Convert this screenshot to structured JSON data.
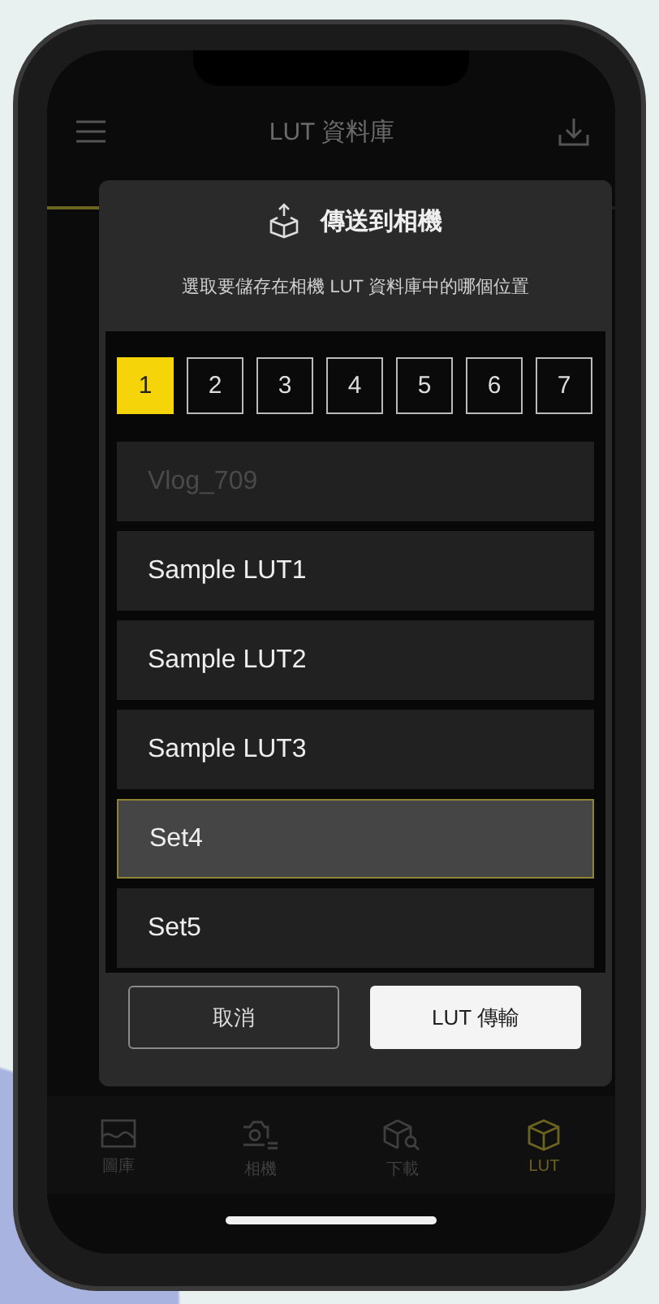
{
  "header": {
    "title": "LUT 資料庫"
  },
  "dialog": {
    "title": "傳送到相機",
    "subtitle": "選取要儲存在相機 LUT 資料庫中的哪個位置",
    "slots": [
      {
        "label": "1",
        "selected": true
      },
      {
        "label": "2",
        "selected": false
      },
      {
        "label": "3",
        "selected": false
      },
      {
        "label": "4",
        "selected": false
      },
      {
        "label": "5",
        "selected": false
      },
      {
        "label": "6",
        "selected": false
      },
      {
        "label": "7",
        "selected": false
      }
    ],
    "luts": [
      {
        "name": "Vlog_709",
        "disabled": true,
        "selected": false
      },
      {
        "name": "Sample LUT1",
        "disabled": false,
        "selected": false
      },
      {
        "name": "Sample LUT2",
        "disabled": false,
        "selected": false
      },
      {
        "name": "Sample LUT3",
        "disabled": false,
        "selected": false
      },
      {
        "name": "Set4",
        "disabled": false,
        "selected": true
      },
      {
        "name": "Set5",
        "disabled": false,
        "selected": false
      }
    ],
    "buttons": [
      {
        "label": "取消",
        "kind": "secondary"
      },
      {
        "label": "LUT 傳輸",
        "kind": "primary"
      }
    ]
  },
  "tab_bar": {
    "items": [
      {
        "label": "圖庫",
        "selected": false
      },
      {
        "label": "相機",
        "selected": false
      },
      {
        "label": "下載",
        "selected": false
      },
      {
        "label": "LUT",
        "selected": true
      }
    ]
  }
}
